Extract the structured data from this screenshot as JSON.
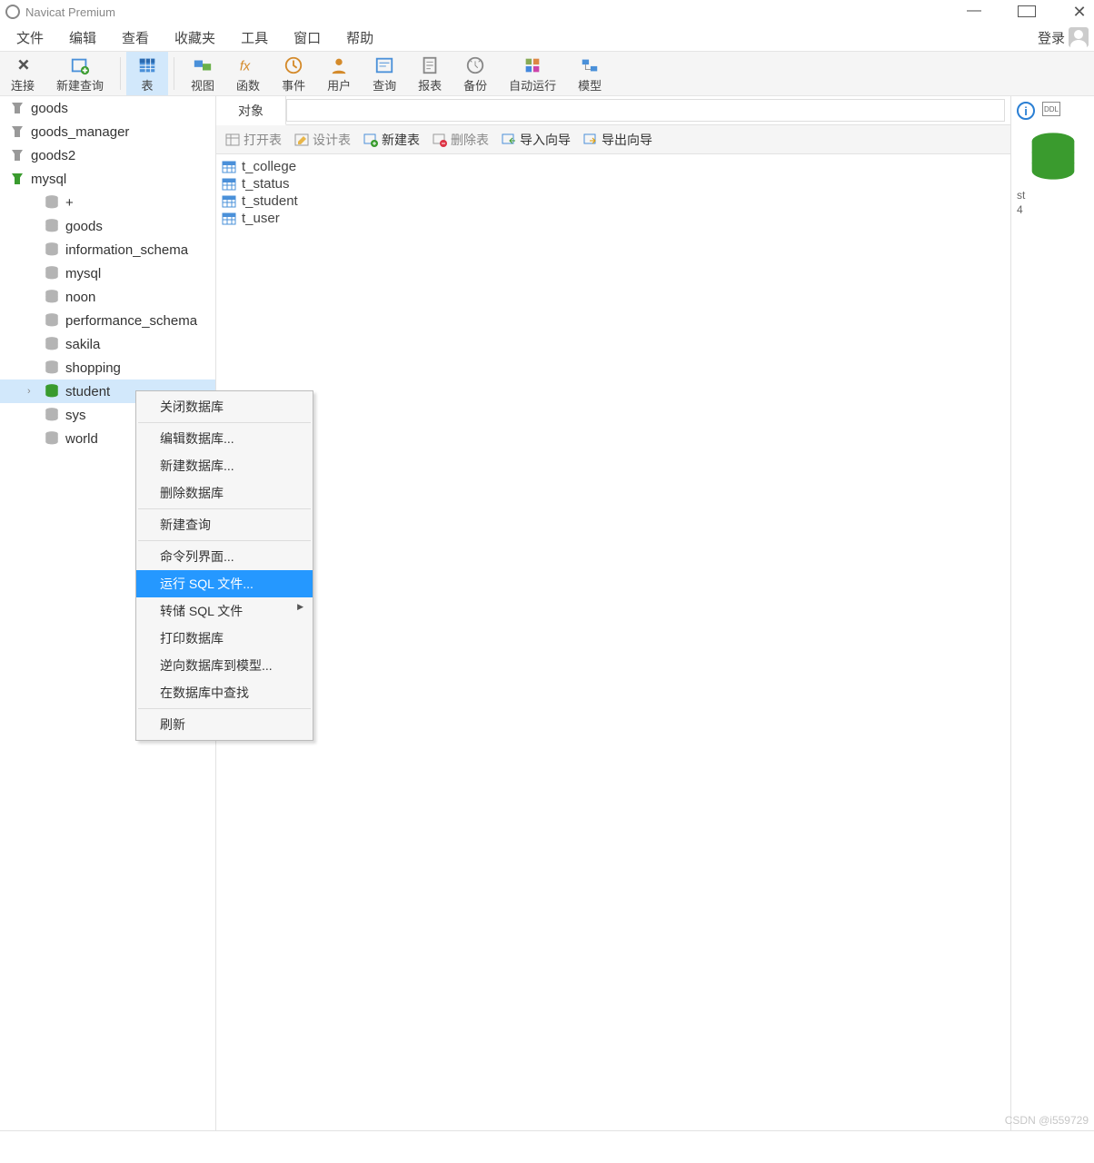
{
  "title": "Navicat Premium",
  "menubar": [
    "文件",
    "编辑",
    "查看",
    "收藏夹",
    "工具",
    "窗口",
    "帮助"
  ],
  "login_label": "登录",
  "toolbar": [
    {
      "label": "连接",
      "icon": "plug",
      "active": false
    },
    {
      "label": "新建查询",
      "icon": "newquery",
      "active": false
    },
    {
      "label": "表",
      "icon": "table",
      "active": true
    },
    {
      "label": "视图",
      "icon": "view",
      "active": false
    },
    {
      "label": "函数",
      "icon": "fx",
      "active": false
    },
    {
      "label": "事件",
      "icon": "event",
      "active": false
    },
    {
      "label": "用户",
      "icon": "user",
      "active": false
    },
    {
      "label": "查询",
      "icon": "query",
      "active": false
    },
    {
      "label": "报表",
      "icon": "report",
      "active": false
    },
    {
      "label": "备份",
      "icon": "backup",
      "active": false
    },
    {
      "label": "自动运行",
      "icon": "auto",
      "active": false
    },
    {
      "label": "模型",
      "icon": "model",
      "active": false
    }
  ],
  "connections": [
    {
      "name": "goods",
      "open": false
    },
    {
      "name": "goods_manager",
      "open": false
    },
    {
      "name": "goods2",
      "open": false
    },
    {
      "name": "mysql",
      "open": true,
      "databases": [
        {
          "name": "+",
          "open": false
        },
        {
          "name": "goods",
          "open": false
        },
        {
          "name": "information_schema",
          "open": false
        },
        {
          "name": "mysql",
          "open": false
        },
        {
          "name": "noon",
          "open": false
        },
        {
          "name": "performance_schema",
          "open": false
        },
        {
          "name": "sakila",
          "open": false
        },
        {
          "name": "shopping",
          "open": false
        },
        {
          "name": "student",
          "open": true,
          "selected": true
        },
        {
          "name": "sys",
          "open": false
        },
        {
          "name": "world",
          "open": false
        }
      ]
    }
  ],
  "tab_label": "对象",
  "subtoolbar": {
    "open": "打开表",
    "design": "设计表",
    "new": "新建表",
    "delete": "删除表",
    "import": "导入向导",
    "export": "导出向导"
  },
  "tables": [
    "t_college",
    "t_status",
    "t_student",
    "t_user"
  ],
  "info": {
    "ddl": "DDL",
    "name": "st",
    "count": "4"
  },
  "context_menu": [
    {
      "label": "关闭数据库"
    },
    {
      "sep": true
    },
    {
      "label": "编辑数据库..."
    },
    {
      "label": "新建数据库..."
    },
    {
      "label": "删除数据库"
    },
    {
      "sep": true
    },
    {
      "label": "新建查询"
    },
    {
      "sep": true
    },
    {
      "label": "命令列界面..."
    },
    {
      "label": "运行 SQL 文件...",
      "hl": true
    },
    {
      "label": "转储 SQL 文件",
      "sub": true
    },
    {
      "label": "打印数据库"
    },
    {
      "label": "逆向数据库到模型..."
    },
    {
      "label": "在数据库中查找"
    },
    {
      "sep": true
    },
    {
      "label": "刷新"
    }
  ],
  "watermark": "CSDN @i559729"
}
